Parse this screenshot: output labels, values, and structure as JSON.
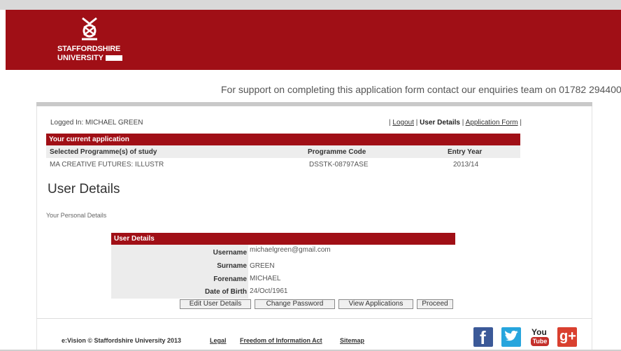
{
  "header": {
    "logo_line1": "STAFFORDSHIRE",
    "logo_line2": "UNIVERSITY",
    "brand_color": "#a00f16"
  },
  "support_text": "For support on completing this application form contact our enquiries team on 01782 294400",
  "nav": {
    "logged_in": "Logged In: MICHAEL GREEN",
    "sep_open": "|",
    "logout": "Logout",
    "sep1": "|",
    "user_details": "User Details",
    "sep2": "|",
    "application_form": "Application Form",
    "sep_close": "|"
  },
  "application": {
    "heading": "Your current application",
    "columns": [
      "Selected Programme(s) of study",
      "Programme Code",
      "Entry Year"
    ],
    "rows": [
      [
        "MA CREATIVE FUTURES: ILLUSTR",
        "DSSTK-08797ASE",
        "2013/14"
      ]
    ]
  },
  "main": {
    "title": "User Details",
    "subtitle": "Your Personal Details"
  },
  "user_details": {
    "heading": "User Details",
    "fields": [
      {
        "label": "Username",
        "value": "michaelgreen@gmail.com"
      },
      {
        "label": "Surname",
        "value": "GREEN"
      },
      {
        "label": "Forename",
        "value": "MICHAEL"
      },
      {
        "label": "Date of Birth",
        "value": "24/Oct/1961"
      }
    ]
  },
  "buttons": {
    "edit": "Edit User Details",
    "password": "Change Password",
    "view": "View Applications",
    "proceed": "Proceed"
  },
  "footer": {
    "copyright": "e:Vision © Staffordshire University 2013",
    "legal": "Legal",
    "foi": "Freedom of Information Act",
    "sitemap": "Sitemap",
    "social": [
      "facebook-icon",
      "twitter-icon",
      "youtube-icon",
      "google-plus-icon"
    ],
    "youtube_you": "You",
    "youtube_tube": "Tube",
    "gplus": "g+",
    "facebook": "f"
  }
}
